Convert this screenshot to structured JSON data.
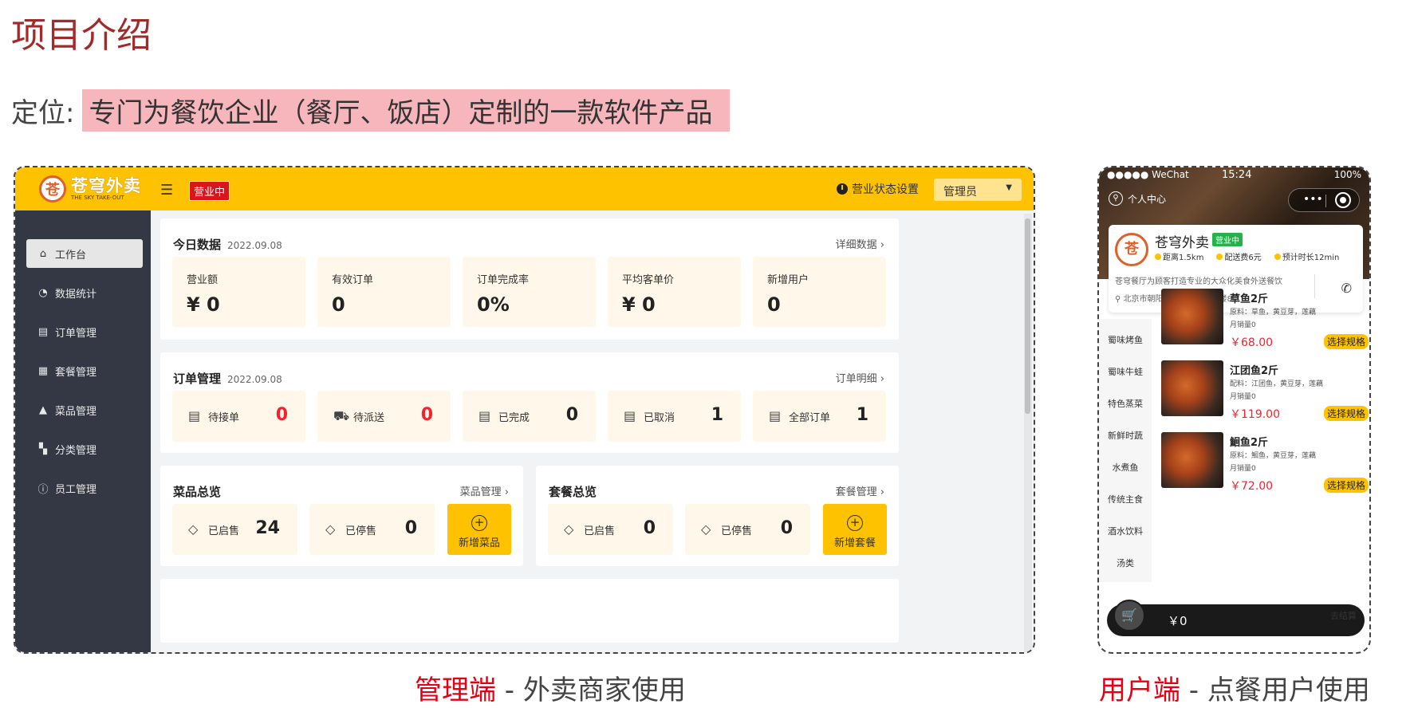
{
  "slide": {
    "title": "项目介绍",
    "positioning_label": "定位:",
    "positioning_text": "专门为餐饮企业（餐厅、饭店）定制的一款软件产品"
  },
  "admin": {
    "logo_cn": "苍穹外卖",
    "logo_en": "THE SKY TAKE-OUT",
    "menu_icon": "menu-fold-icon",
    "status_pill": "营业中",
    "status_settings": "营业状态设置",
    "user_select": "管理员",
    "sidebar": [
      {
        "label": "工作台",
        "icon": "home-icon",
        "active": true
      },
      {
        "label": "数据统计",
        "icon": "chart-icon",
        "active": false
      },
      {
        "label": "订单管理",
        "icon": "clipboard-icon",
        "active": false
      },
      {
        "label": "套餐管理",
        "icon": "gift-icon",
        "active": false
      },
      {
        "label": "菜品管理",
        "icon": "dish-icon",
        "active": false
      },
      {
        "label": "分类管理",
        "icon": "grid-icon",
        "active": false
      },
      {
        "label": "员工管理",
        "icon": "info-icon",
        "active": false
      }
    ],
    "today": {
      "title": "今日数据",
      "date": "2022.09.08",
      "link": "详细数据",
      "tiles": [
        {
          "label": "营业额",
          "value": "¥ 0"
        },
        {
          "label": "有效订单",
          "value": "0"
        },
        {
          "label": "订单完成率",
          "value": "0%"
        },
        {
          "label": "平均客单价",
          "value": "¥ 0"
        },
        {
          "label": "新增用户",
          "value": "0"
        }
      ]
    },
    "orders": {
      "title": "订单管理",
      "date": "2022.09.08",
      "link": "订单明细",
      "tiles": [
        {
          "label": "待接单",
          "value": "0",
          "highlight": true
        },
        {
          "label": "待派送",
          "value": "0",
          "highlight": true
        },
        {
          "label": "已完成",
          "value": "0",
          "highlight": false
        },
        {
          "label": "已取消",
          "value": "1",
          "highlight": false
        },
        {
          "label": "全部订单",
          "value": "1",
          "highlight": false
        }
      ]
    },
    "dishes": {
      "title": "菜品总览",
      "link": "菜品管理",
      "on_label": "已启售",
      "on_value": "24",
      "off_label": "已停售",
      "off_value": "0",
      "add_label": "新增菜品"
    },
    "combos": {
      "title": "套餐总览",
      "link": "套餐管理",
      "on_label": "已启售",
      "on_value": "0",
      "off_label": "已停售",
      "off_value": "0",
      "add_label": "新增套餐"
    }
  },
  "phone": {
    "carrier": "●●●●● WeChat",
    "time": "15:24",
    "battery": "100%",
    "user_center": "个人中心",
    "shop_name": "苍穹外卖",
    "shop_badge": "营业中",
    "distance": "距离1.5km",
    "delivery_fee": "配送费6元",
    "eta": "预计时长12min",
    "description": "苍穹餐厅为顾客打造专业的大众化美食外送餐饮",
    "address": "北京市朝阳区新街大道一号楼8层",
    "categories": [
      "蜀味烤鱼",
      "蜀味牛蛙",
      "特色蒸菜",
      "新鲜时蔬",
      "水煮鱼",
      "传统主食",
      "酒水饮料",
      "汤类"
    ],
    "dishes": [
      {
        "name": "草鱼2斤",
        "desc": "原料：草鱼，黄豆芽，莲藕",
        "sold": "月销量0",
        "price": "￥68.00",
        "button": "选择规格"
      },
      {
        "name": "江团鱼2斤",
        "desc": "配料：江团鱼，黄豆芽，莲藕",
        "sold": "月销量0",
        "price": "￥119.00",
        "button": "选择规格"
      },
      {
        "name": "鮰鱼2斤",
        "desc": "原料：鮰鱼，黄豆芽，莲藕",
        "sold": "月销量0",
        "price": "￥72.00",
        "button": "选择规格"
      }
    ],
    "cart_amount": "￥0",
    "cart_go": "去结算"
  },
  "captions": {
    "admin_red": "管理端",
    "admin_rest": " - 外卖商家使用",
    "user_red": "用户端",
    "user_rest": " - 点餐用户使用"
  }
}
